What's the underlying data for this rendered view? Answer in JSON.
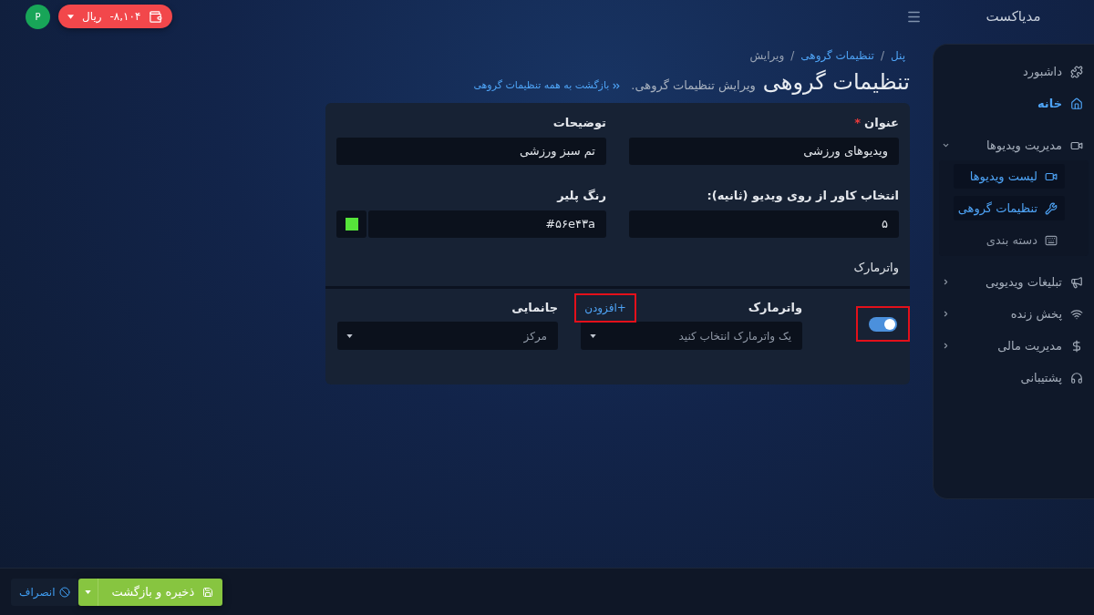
{
  "header": {
    "logo": "مدیاکست",
    "wallet": {
      "amount": "-۸,۱۰۴",
      "currency": "ریال"
    },
    "avatar": "P"
  },
  "sidebar": {
    "items": [
      {
        "label": "داشبورد",
        "selected": false
      },
      {
        "label": "خانه",
        "selected": true
      },
      {
        "label": "مدیریت ویدیوها",
        "selected": false,
        "expanded": true,
        "children": [
          {
            "label": "لیست ویدیوها",
            "selected": true
          },
          {
            "label": "تنظیمات گروهی",
            "selected": true
          },
          {
            "label": "دسته بندی",
            "selected": false
          }
        ]
      },
      {
        "label": "تبلیغات ویدیویی",
        "selected": false,
        "expanded": false
      },
      {
        "label": "پخش زنده",
        "selected": false,
        "expanded": false
      },
      {
        "label": "مدیریت مالی",
        "selected": false,
        "expanded": false
      },
      {
        "label": "پشتیبانی",
        "selected": false
      }
    ]
  },
  "breadcrumb": {
    "items": [
      {
        "label": "پنل",
        "link": true
      },
      {
        "separator": "/",
        "label": "تنظیمات گروهی",
        "link": true
      },
      {
        "separator": "/",
        "label": "ویرایش",
        "link": false
      }
    ]
  },
  "page": {
    "title": "تنظیمات گروهی",
    "subtitle": "ویرایش تنظیمات گروهی.",
    "back_link": "بازگشت به همه تنظیمات گروهی"
  },
  "form": {
    "fields": [
      {
        "kind": "text",
        "label": "عنوان",
        "required_mark": "*",
        "value": "ویدیوهای ورزشی"
      },
      {
        "kind": "text",
        "label": "توضیحات",
        "value": "تم سبز ورزشی"
      },
      {
        "kind": "text",
        "label": "انتخاب کاور از روی ویدیو (ثانیه):",
        "value": "۵"
      },
      {
        "kind": "color",
        "label": "رنگ پلیر",
        "value": "#۵۶e۴۳a",
        "color": "#56e43a"
      }
    ],
    "section_title": "واترمارک",
    "watermark": {
      "enabled": true,
      "highlighted": true,
      "label": "واترمارک",
      "add_link": {
        "label": "+افزودن",
        "highlighted": true
      },
      "placeholder": "یک واترمارک انتخاب کنید"
    },
    "position": {
      "label": "جانمایی",
      "value": "مرکز"
    }
  },
  "footer": {
    "save_button": "ذخیره و بازگشت",
    "cancel_button": "انصراف"
  }
}
